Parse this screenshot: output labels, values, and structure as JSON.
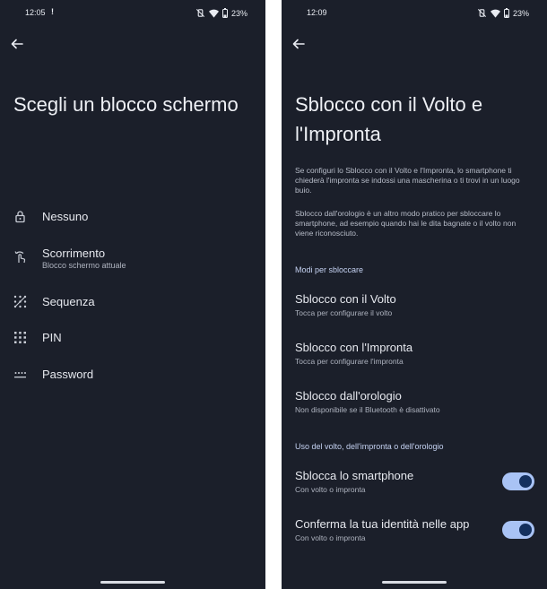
{
  "left": {
    "status": {
      "time": "12:05",
      "notification": "!",
      "battery": "23%"
    },
    "title": "Scegli un blocco schermo",
    "options": [
      {
        "label": "Nessuno",
        "subtitle": "",
        "icon": "lock-icon"
      },
      {
        "label": "Scorrimento",
        "subtitle": "Blocco schermo attuale",
        "icon": "swipe-icon"
      },
      {
        "label": "Sequenza",
        "subtitle": "",
        "icon": "pattern-icon"
      },
      {
        "label": "PIN",
        "subtitle": "",
        "icon": "pin-icon"
      },
      {
        "label": "Password",
        "subtitle": "",
        "icon": "password-icon"
      }
    ]
  },
  "right": {
    "status": {
      "time": "12:09",
      "battery": "23%"
    },
    "title": "Sblocco con il Volto e l'Impronta",
    "para1": "Se configuri lo Sblocco con il Volto e l'Impronta, lo smartphone ti chiederà l'impronta se indossi una mascherina o ti trovi in un luogo buio.",
    "para2": "Sblocco dall'orologio è un altro modo pratico per sbloccare lo smartphone, ad esempio quando hai le dita bagnate o il volto non viene riconosciuto.",
    "section_methods": "Modi per sbloccare",
    "methods": [
      {
        "label": "Sblocco con il Volto",
        "subtitle": "Tocca per configurare il volto"
      },
      {
        "label": "Sblocco con l'Impronta",
        "subtitle": "Tocca per configurare l'impronta"
      },
      {
        "label": "Sblocco dall'orologio",
        "subtitle": "Non disponibile se il Bluetooth è disattivato"
      }
    ],
    "section_usage": "Uso del volto, dell'impronta o dell'orologio",
    "usage": [
      {
        "label": "Sblocca lo smartphone",
        "subtitle": "Con volto o impronta",
        "enabled": true
      },
      {
        "label": "Conferma la tua identità nelle app",
        "subtitle": "Con volto o impronta",
        "enabled": true
      }
    ]
  },
  "colors": {
    "background": "#1b1f2a",
    "accent": "#a9c3f5",
    "toggle_knob": "#14305e"
  }
}
